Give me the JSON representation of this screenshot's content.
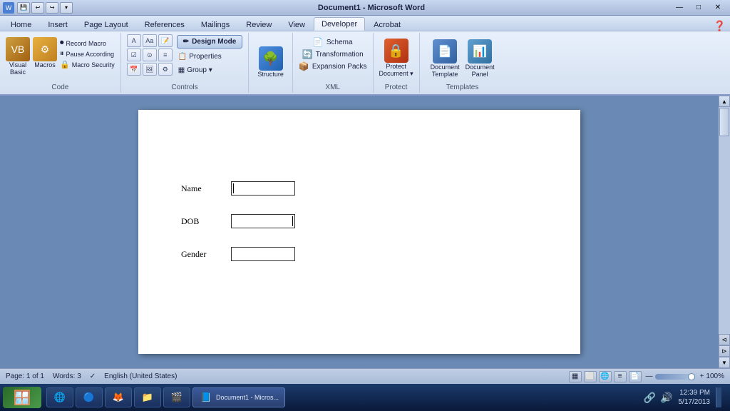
{
  "titlebar": {
    "title": "Document1 - Microsoft Word",
    "quick_buttons": [
      "↩",
      "↩",
      "↩"
    ],
    "controls": [
      "—",
      "□",
      "✕"
    ]
  },
  "tabs": [
    {
      "label": "Home",
      "active": false
    },
    {
      "label": "Insert",
      "active": false
    },
    {
      "label": "Page Layout",
      "active": false
    },
    {
      "label": "References",
      "active": false
    },
    {
      "label": "Mailings",
      "active": false
    },
    {
      "label": "Review",
      "active": false
    },
    {
      "label": "View",
      "active": false
    },
    {
      "label": "Developer",
      "active": true
    },
    {
      "label": "Acrobat",
      "active": false
    }
  ],
  "ribbon": {
    "groups": [
      {
        "name": "Code",
        "items": [
          {
            "label": "Visual\nBasic",
            "type": "large-btn"
          },
          {
            "label": "Macros",
            "type": "large-btn"
          },
          {
            "subItems": [
              "Record Macro",
              "Pause Recording",
              "Macro Security"
            ]
          }
        ]
      },
      {
        "name": "Controls",
        "designMode": "Design Mode",
        "props": "Properties",
        "group": "Group ▼"
      },
      {
        "name": "Structure",
        "label": "Structure"
      },
      {
        "name": "XML",
        "items": [
          "Schema",
          "Transformation",
          "Expansion Packs"
        ]
      },
      {
        "name": "Protect",
        "items": [
          {
            "label": "Protect\nDocument ▼"
          }
        ]
      },
      {
        "name": "Templates",
        "items": [
          {
            "label": "Document\nTemplate"
          },
          {
            "label": "Document\nPanel"
          }
        ]
      }
    ]
  },
  "document": {
    "fields": [
      {
        "label": "Name",
        "value": "",
        "cursor": true
      },
      {
        "label": "DOB",
        "value": "",
        "cursor": true
      },
      {
        "label": "Gender",
        "value": "",
        "cursor": false
      }
    ]
  },
  "statusbar": {
    "page": "Page: 1 of 1",
    "words": "Words: 3",
    "language": "English (United States)",
    "zoom": "100%"
  },
  "taskbar": {
    "start_label": "Start",
    "apps": [
      {
        "icon": "🌐",
        "label": ""
      },
      {
        "icon": "🔵",
        "label": ""
      },
      {
        "icon": "🦊",
        "label": ""
      },
      {
        "icon": "📁",
        "label": ""
      },
      {
        "icon": "🎬",
        "label": ""
      },
      {
        "icon": "📘",
        "label": ""
      }
    ],
    "time": "12:39 PM",
    "date": "5/17/2013"
  }
}
